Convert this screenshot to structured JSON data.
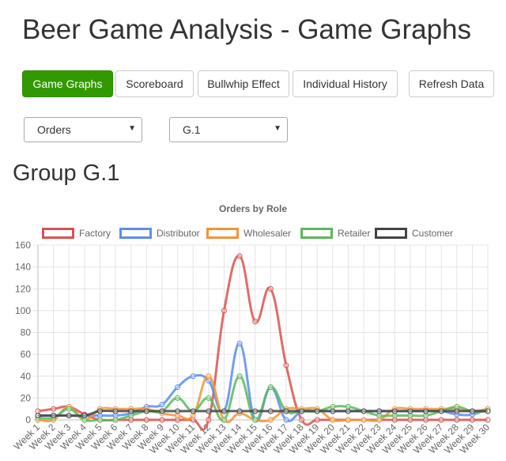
{
  "page": {
    "title": "Beer Game Analysis - Game Graphs"
  },
  "nav": {
    "game_graphs": "Game Graphs",
    "scoreboard": "Scoreboard",
    "bullwhip": "Bullwhip Effect",
    "history": "Individual History",
    "refresh": "Refresh Data"
  },
  "filters": {
    "metric": "Orders",
    "group": "G.1"
  },
  "group_heading": "Group G.1",
  "chart_data": {
    "type": "line",
    "title": "Orders by Role",
    "xlabel": "",
    "ylabel": "",
    "ylim": [
      0,
      160
    ],
    "yticks": [
      0,
      20,
      40,
      60,
      80,
      100,
      120,
      140,
      160
    ],
    "legend_position": "top",
    "grid": true,
    "categories": [
      "Week 1",
      "Week 2",
      "Week 3",
      "Week 4",
      "Week 5",
      "Week 6",
      "Week 7",
      "Week 8",
      "Week 9",
      "Week 10",
      "Week 11",
      "Week 12",
      "Week 13",
      "Week 14",
      "Week 15",
      "Week 16",
      "Week 17",
      "Week 18",
      "Week 19",
      "Week 20",
      "Week 21",
      "Week 22",
      "Week 23",
      "Week 24",
      "Week 25",
      "Week 26",
      "Week 27",
      "Week 28",
      "Week 29",
      "Week 30"
    ],
    "series": [
      {
        "name": "Factory",
        "color": "#d9534f",
        "values": [
          8,
          10,
          12,
          5,
          0,
          0,
          0,
          0,
          0,
          0,
          0,
          0,
          100,
          150,
          90,
          120,
          50,
          0,
          0,
          0,
          0,
          0,
          0,
          0,
          0,
          0,
          0,
          0,
          0,
          0
        ]
      },
      {
        "name": "Distributor",
        "color": "#5b8def",
        "values": [
          4,
          4,
          4,
          4,
          4,
          4,
          6,
          12,
          14,
          30,
          40,
          36,
          8,
          70,
          0,
          30,
          0,
          8,
          8,
          8,
          8,
          8,
          8,
          8,
          8,
          8,
          8,
          5,
          5,
          10
        ]
      },
      {
        "name": "Wholesaler",
        "color": "#f0953a",
        "values": [
          0,
          0,
          12,
          0,
          10,
          10,
          10,
          10,
          6,
          4,
          4,
          40,
          0,
          6,
          0,
          0,
          10,
          10,
          10,
          0,
          0,
          0,
          0,
          10,
          10,
          10,
          10,
          10,
          8,
          10
        ]
      },
      {
        "name": "Retailer",
        "color": "#5cb85c",
        "values": [
          2,
          2,
          10,
          0,
          0,
          0,
          4,
          8,
          8,
          20,
          8,
          20,
          0,
          40,
          0,
          30,
          8,
          8,
          8,
          12,
          12,
          8,
          4,
          4,
          4,
          4,
          8,
          12,
          8,
          8
        ]
      },
      {
        "name": "Customer",
        "color": "#444444",
        "values": [
          4,
          4,
          4,
          4,
          8,
          8,
          8,
          8,
          8,
          8,
          8,
          8,
          8,
          8,
          8,
          8,
          8,
          8,
          8,
          8,
          8,
          8,
          8,
          8,
          8,
          8,
          8,
          8,
          8,
          8
        ]
      }
    ]
  }
}
